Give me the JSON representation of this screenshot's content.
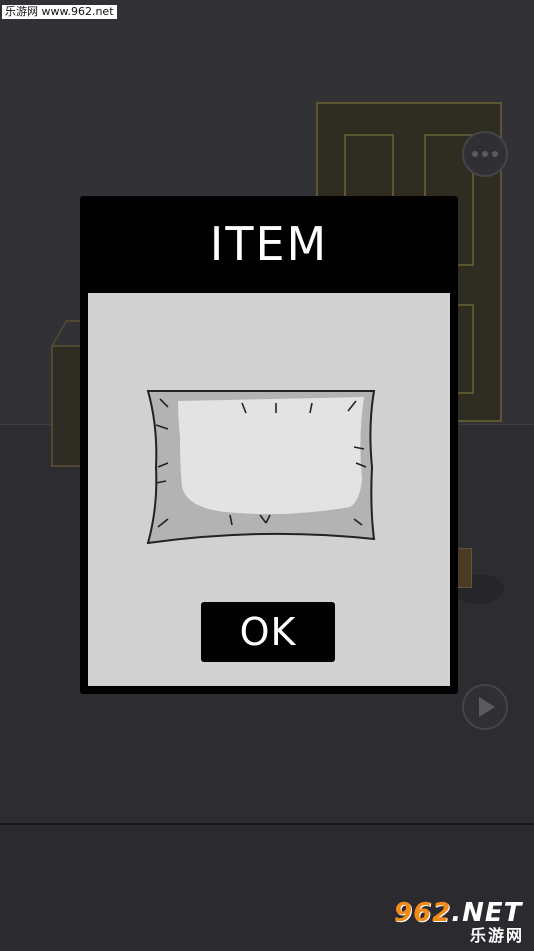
{
  "watermark": {
    "text": "乐游网 www.962.net"
  },
  "dialog": {
    "title": "ITEM",
    "item_icon": "pillow-icon",
    "ok_label": "OK"
  },
  "controls": {
    "menu_icon": "more-dots-icon",
    "play_icon": "play-icon"
  },
  "logo": {
    "number": "962",
    "suffix": ".NET",
    "subtitle": "乐游网"
  },
  "colors": {
    "dialog_frame": "#000000",
    "dialog_body": "#d1d1d1",
    "wall": "#313136",
    "door_trim": "#5a5532"
  }
}
